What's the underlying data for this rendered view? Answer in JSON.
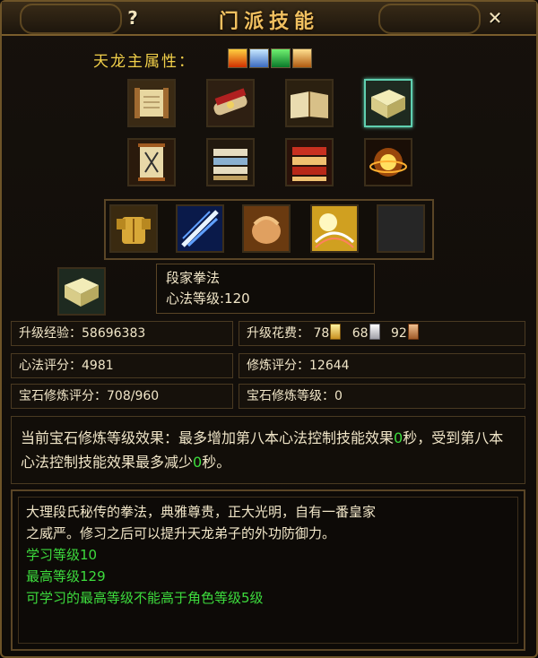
{
  "window": {
    "title": "门派技能",
    "help_label": "?",
    "close_label": "✕"
  },
  "attributes": {
    "label": "天龙主属性：",
    "icons": [
      "fire-attribute-icon",
      "ice-attribute-icon",
      "poison-attribute-icon",
      "mystic-attribute-icon"
    ]
  },
  "skill_books": {
    "row1": [
      "scroll-book-icon",
      "bound-scroll-icon",
      "open-book-icon",
      "jade-book-icon"
    ],
    "row2": [
      "talisman-scroll-icon",
      "stacked-books-icon",
      "red-books-icon",
      "golden-burst-icon"
    ],
    "selected": "jade-book-icon"
  },
  "passives": [
    "golden-armor-icon",
    "blue-slash-icon",
    "palm-strike-icon",
    "sunburst-icon",
    "empty-slot-icon"
  ],
  "selected_skill": {
    "name": "段家拳法",
    "level_text": "心法等级:120"
  },
  "stats": {
    "upgrade_exp_label": "升级经验：",
    "upgrade_exp_value": "58696383",
    "upgrade_cost_label": "升级花费：",
    "cost_gold": "78",
    "cost_silver": "68",
    "cost_copper": "92",
    "xinfa_score_label": "心法评分：",
    "xinfa_score_value": "4981",
    "cultivation_score_label": "修炼评分：",
    "cultivation_score_value": "12644",
    "gem_score_label": "宝石修炼评分：",
    "gem_score_value": "708/960",
    "gem_level_label": "宝石修炼等级：",
    "gem_level_value": "0"
  },
  "effect": {
    "part1": "当前宝石修炼等级效果：最多增加第八本心法控制技能效果",
    "value1": "0",
    "part2": "秒，受到第八本心法控制技能效果最多减少",
    "value2": "0",
    "part3": "秒。"
  },
  "description": {
    "line1": "大理段氏秘传的拳法，典雅尊贵，正大光明，自有一番皇家",
    "line2": "之威严。修习之后可以提升天龙弟子的外功防御力。",
    "learn_level": "学习等级10",
    "max_level": "最高等级129",
    "note": "可学习的最高等级不能高于角色等级5级"
  },
  "colors": {
    "accent_gold": "#f0c060",
    "label_yellow": "#f2d04a",
    "green_text": "#3ddc3d",
    "selected_frame": "#5fd0b0"
  }
}
